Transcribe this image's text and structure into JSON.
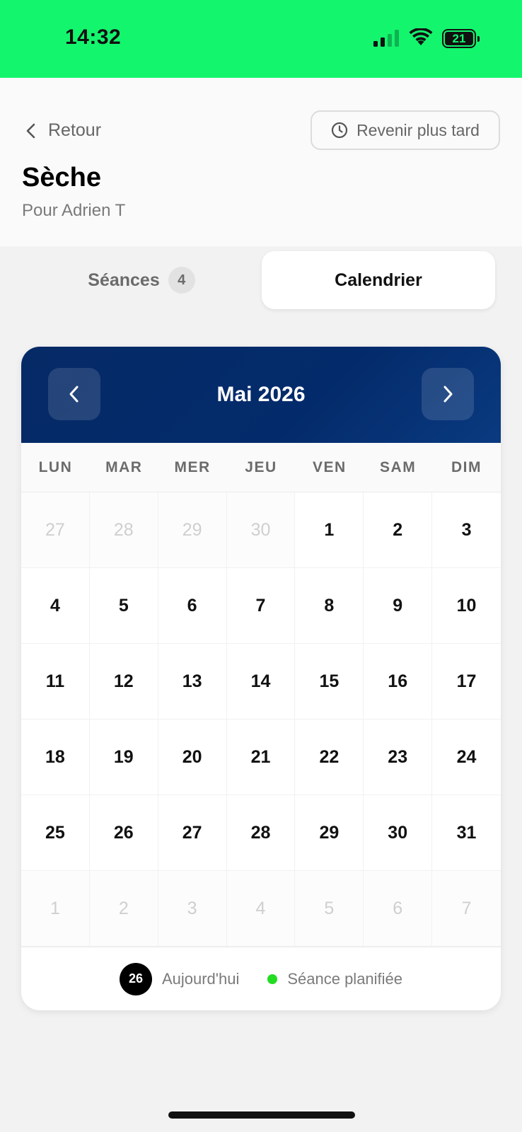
{
  "status_bar": {
    "time": "14:32",
    "battery_level": "21",
    "icons": [
      "signal-icon",
      "wifi-icon",
      "battery-icon"
    ]
  },
  "header": {
    "back_label": "Retour",
    "later_label": "Revenir plus tard",
    "title": "Sèche",
    "subtitle": "Pour Adrien T"
  },
  "tabs": {
    "sessions_label": "Séances",
    "sessions_count": "4",
    "calendar_label": "Calendrier",
    "active": "calendar"
  },
  "calendar": {
    "month_label": "Mai 2026",
    "weekdays": [
      "LUN",
      "MAR",
      "MER",
      "JEU",
      "VEN",
      "SAM",
      "DIM"
    ],
    "days": [
      {
        "label": "27",
        "outside": true
      },
      {
        "label": "28",
        "outside": true
      },
      {
        "label": "29",
        "outside": true
      },
      {
        "label": "30",
        "outside": true
      },
      {
        "label": "1"
      },
      {
        "label": "2"
      },
      {
        "label": "3"
      },
      {
        "label": "4"
      },
      {
        "label": "5"
      },
      {
        "label": "6"
      },
      {
        "label": "7"
      },
      {
        "label": "8"
      },
      {
        "label": "9"
      },
      {
        "label": "10"
      },
      {
        "label": "11"
      },
      {
        "label": "12"
      },
      {
        "label": "13"
      },
      {
        "label": "14"
      },
      {
        "label": "15"
      },
      {
        "label": "16"
      },
      {
        "label": "17"
      },
      {
        "label": "18"
      },
      {
        "label": "19"
      },
      {
        "label": "20"
      },
      {
        "label": "21"
      },
      {
        "label": "22"
      },
      {
        "label": "23"
      },
      {
        "label": "24"
      },
      {
        "label": "25"
      },
      {
        "label": "26"
      },
      {
        "label": "27"
      },
      {
        "label": "28"
      },
      {
        "label": "29"
      },
      {
        "label": "30"
      },
      {
        "label": "31"
      },
      {
        "label": "1",
        "outside": true
      },
      {
        "label": "2",
        "outside": true
      },
      {
        "label": "3",
        "outside": true
      },
      {
        "label": "4",
        "outside": true
      },
      {
        "label": "5",
        "outside": true
      },
      {
        "label": "6",
        "outside": true
      },
      {
        "label": "7",
        "outside": true
      }
    ],
    "legend": {
      "today_number": "26",
      "today_label": "Aujourd'hui",
      "session_label": "Séance planifiée"
    }
  },
  "colors": {
    "status_bar": "#14f56e",
    "calendar_header": "#032b6b",
    "session_dot": "#22dd22"
  }
}
